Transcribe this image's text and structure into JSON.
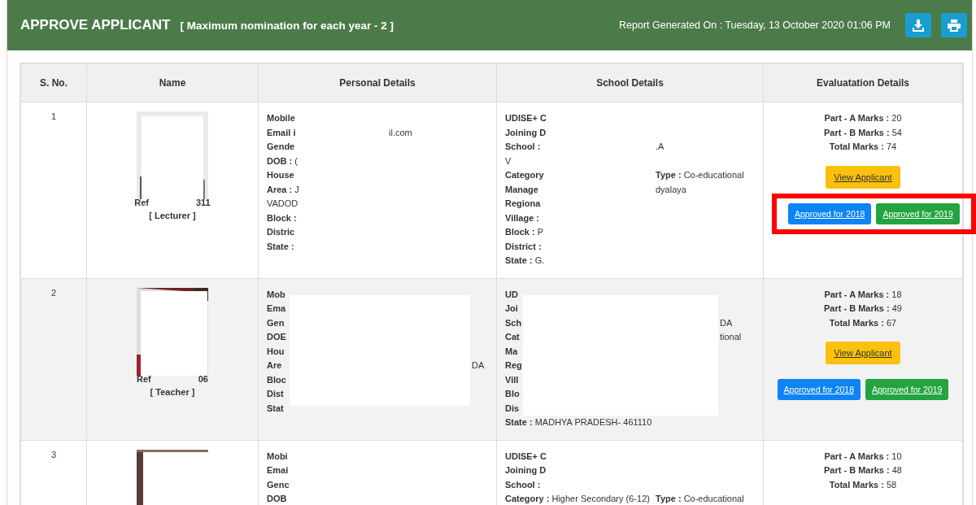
{
  "header": {
    "title": "APPROVE APPLICANT",
    "subtitle": "[ Maximum nomination for each year - 2 ]",
    "report": "Report Generated On : Tuesday, 13 October 2020 01:06 PM"
  },
  "table": {
    "columns": [
      "S. No.",
      "Name",
      "Personal Details",
      "School Details",
      "Evaluatation Details"
    ],
    "rows": [
      {
        "sno": "1",
        "photo": {
          "kind": "picture"
        },
        "ref": "Ref",
        "ref_tail": "311",
        "role": "[ Lecturer ]",
        "personal": {
          "lines": [
            {
              "text": "**Mobile**"
            },
            {
              "text": "**Email i**",
              "right": "il.com"
            },
            {
              "text": "**Gende**"
            },
            {
              "text": "**DOB :** ("
            },
            {
              "text": "**House**"
            },
            {
              "text": "**Area :** J"
            },
            {
              "text": "VADOD"
            },
            {
              "text": "**Block :**"
            },
            {
              "text": "**Distric**"
            },
            {
              "text": "**State :**"
            }
          ]
        },
        "school": {
          "lines": [
            {
              "text": "**UDISE+ C**"
            },
            {
              "text": "**Joining D**"
            },
            {
              "text": "**School :**",
              "right": ".A"
            },
            {
              "text": "V"
            },
            {
              "text": "**Category**",
              "right": "**Type :** Co-educational"
            },
            {
              "text": "**Manage**",
              "right": "dyalaya"
            },
            {
              "text": "**Regiona**"
            },
            {
              "text": "**Village :**"
            },
            {
              "text": "**Block :** P"
            },
            {
              "text": "**District :**"
            },
            {
              "text": "**State :** G."
            }
          ]
        },
        "marks": [
          {
            "label": "Part - A Marks :",
            "value": "20"
          },
          {
            "label": "Part - B Marks :",
            "value": "54"
          },
          {
            "label": "Total Marks :",
            "value": "74"
          }
        ],
        "view": "View Applicant",
        "approve": [
          "Approved for 2018",
          "Approved for 2019"
        ],
        "highlighted": true
      },
      {
        "sno": "2",
        "photo": {
          "kind": "picture"
        },
        "ref": "Ref",
        "ref_tail": "06",
        "role": "[ Teacher ]",
        "personal": {
          "redacted": true,
          "lines": [
            {
              "text": "**Mob**"
            },
            {
              "text": "**Ema**"
            },
            {
              "text": "**Gen**"
            },
            {
              "text": "**DOE**"
            },
            {
              "text": "**Hou**"
            },
            {
              "text": "**Are**",
              "right": "DA"
            },
            {
              "text": "**Bloc**"
            },
            {
              "text": "**Dist**"
            },
            {
              "text": "**Stat**"
            }
          ]
        },
        "school": {
          "redacted": true,
          "lines": [
            {
              "text": "**UD**"
            },
            {
              "text": "**Joi**"
            },
            {
              "text": "**Sch**",
              "right": "DA"
            },
            {
              "text": "**Cat**",
              "right": "tional"
            },
            {
              "text": "**Ma**"
            },
            {
              "text": "**Reg**"
            },
            {
              "text": "**Vill**"
            },
            {
              "text": "**Blo**"
            },
            {
              "text": "**Dis**"
            },
            {
              "text": "**State :** MADHYA PRADESH- 461110"
            }
          ]
        },
        "marks": [
          {
            "label": "Part - A Marks :",
            "value": "18"
          },
          {
            "label": "Part - B Marks :",
            "value": "49"
          },
          {
            "label": "Total Marks :",
            "value": "67"
          }
        ],
        "view": "View Applicant",
        "approve": [
          "Approved for 2018",
          "Approved for 2019"
        ]
      },
      {
        "sno": "3",
        "photo": {
          "kind": "picture"
        },
        "personal": {
          "lines": [
            {
              "text": "**Mobi**"
            },
            {
              "text": "**Emai**"
            },
            {
              "text": "**Genc**"
            },
            {
              "text": "**DOB**"
            }
          ]
        },
        "school": {
          "lines": [
            {
              "text": "**UDISE+ C**"
            },
            {
              "text": "**Joining D**"
            },
            {
              "text": "**School :**"
            },
            {
              "text": "**Category :** Higher Secondary (6-12)",
              "right": "**Type :** Co-educational"
            }
          ]
        },
        "marks": [
          {
            "label": "Part - A Marks :",
            "value": "10"
          },
          {
            "label": "Part - B Marks :",
            "value": "48"
          },
          {
            "label": "Total Marks :",
            "value": "58"
          }
        ]
      }
    ]
  }
}
